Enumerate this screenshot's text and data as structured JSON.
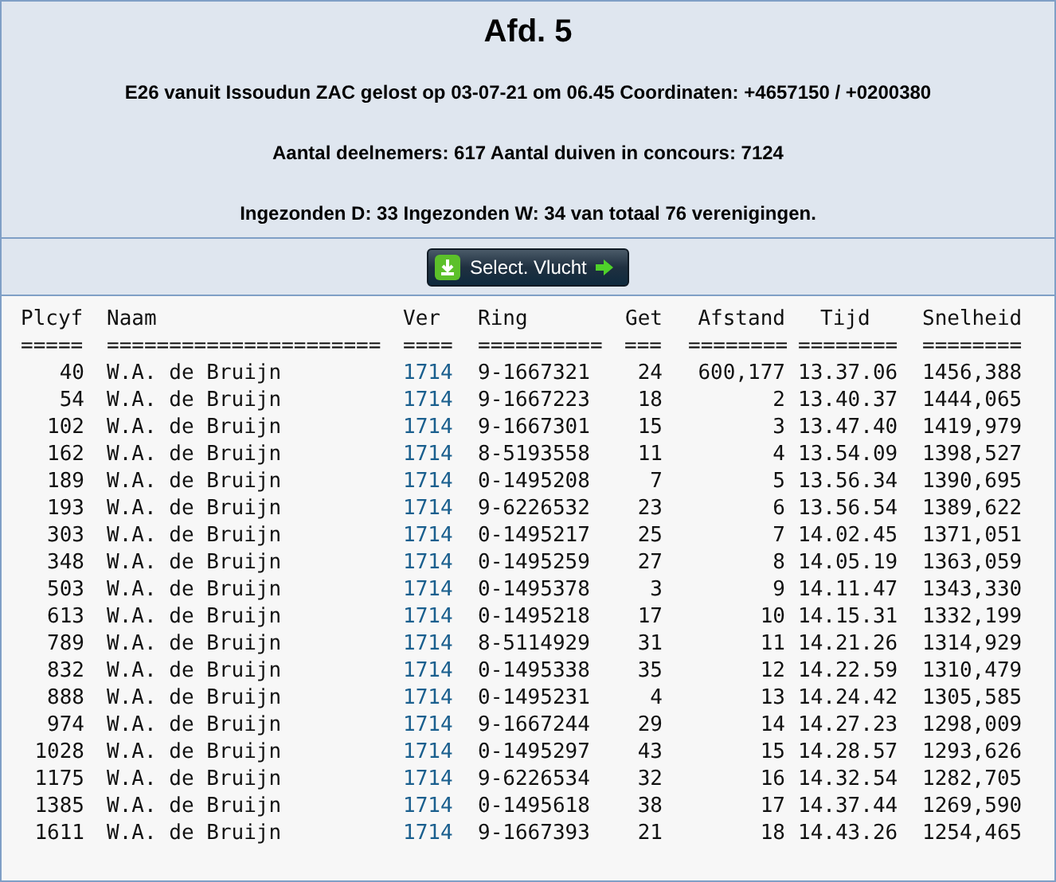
{
  "title": "Afd. 5",
  "info": [
    "E26 vanuit Issoudun ZAC gelost op 03-07-21 om 06.45 Coordinaten: +4657150 / +0200380",
    "Aantal deelnemers: 617 Aantal duiven in concours: 7124",
    "Ingezonden D: 33 Ingezonden W: 34 van totaal 76 verenigingen."
  ],
  "button": "Select. Vlucht",
  "table": {
    "columns": [
      {
        "label": "Plcyf",
        "rule": "====="
      },
      {
        "label": "Naam",
        "rule": "======================"
      },
      {
        "label": "Ver",
        "rule": "===="
      },
      {
        "label": "Ring",
        "rule": "=========="
      },
      {
        "label": "Get",
        "rule": "==="
      },
      {
        "label": "Afstand",
        "rule": "========"
      },
      {
        "label": "Tijd",
        "rule": "========"
      },
      {
        "label": "Snelheid",
        "rule": "========"
      }
    ],
    "rows": [
      [
        "40",
        "W.A. de Bruijn",
        "1714",
        "9-1667321",
        "24",
        "600,177",
        "13.37.06",
        "1456,388"
      ],
      [
        "54",
        "W.A. de Bruijn",
        "1714",
        "9-1667223",
        "18",
        "2",
        "13.40.37",
        "1444,065"
      ],
      [
        "102",
        "W.A. de Bruijn",
        "1714",
        "9-1667301",
        "15",
        "3",
        "13.47.40",
        "1419,979"
      ],
      [
        "162",
        "W.A. de Bruijn",
        "1714",
        "8-5193558",
        "11",
        "4",
        "13.54.09",
        "1398,527"
      ],
      [
        "189",
        "W.A. de Bruijn",
        "1714",
        "0-1495208",
        "7",
        "5",
        "13.56.34",
        "1390,695"
      ],
      [
        "193",
        "W.A. de Bruijn",
        "1714",
        "9-6226532",
        "23",
        "6",
        "13.56.54",
        "1389,622"
      ],
      [
        "303",
        "W.A. de Bruijn",
        "1714",
        "0-1495217",
        "25",
        "7",
        "14.02.45",
        "1371,051"
      ],
      [
        "348",
        "W.A. de Bruijn",
        "1714",
        "0-1495259",
        "27",
        "8",
        "14.05.19",
        "1363,059"
      ],
      [
        "503",
        "W.A. de Bruijn",
        "1714",
        "0-1495378",
        "3",
        "9",
        "14.11.47",
        "1343,330"
      ],
      [
        "613",
        "W.A. de Bruijn",
        "1714",
        "0-1495218",
        "17",
        "10",
        "14.15.31",
        "1332,199"
      ],
      [
        "789",
        "W.A. de Bruijn",
        "1714",
        "8-5114929",
        "31",
        "11",
        "14.21.26",
        "1314,929"
      ],
      [
        "832",
        "W.A. de Bruijn",
        "1714",
        "0-1495338",
        "35",
        "12",
        "14.22.59",
        "1310,479"
      ],
      [
        "888",
        "W.A. de Bruijn",
        "1714",
        "0-1495231",
        "4",
        "13",
        "14.24.42",
        "1305,585"
      ],
      [
        "974",
        "W.A. de Bruijn",
        "1714",
        "9-1667244",
        "29",
        "14",
        "14.27.23",
        "1298,009"
      ],
      [
        "1028",
        "W.A. de Bruijn",
        "1714",
        "0-1495297",
        "43",
        "15",
        "14.28.57",
        "1293,626"
      ],
      [
        "1175",
        "W.A. de Bruijn",
        "1714",
        "9-6226534",
        "32",
        "16",
        "14.32.54",
        "1282,705"
      ],
      [
        "1385",
        "W.A. de Bruijn",
        "1714",
        "0-1495618",
        "38",
        "17",
        "14.37.44",
        "1269,590"
      ],
      [
        "1611",
        "W.A. de Bruijn",
        "1714",
        "9-1667393",
        "21",
        "18",
        "14.43.26",
        "1254,465"
      ]
    ]
  }
}
